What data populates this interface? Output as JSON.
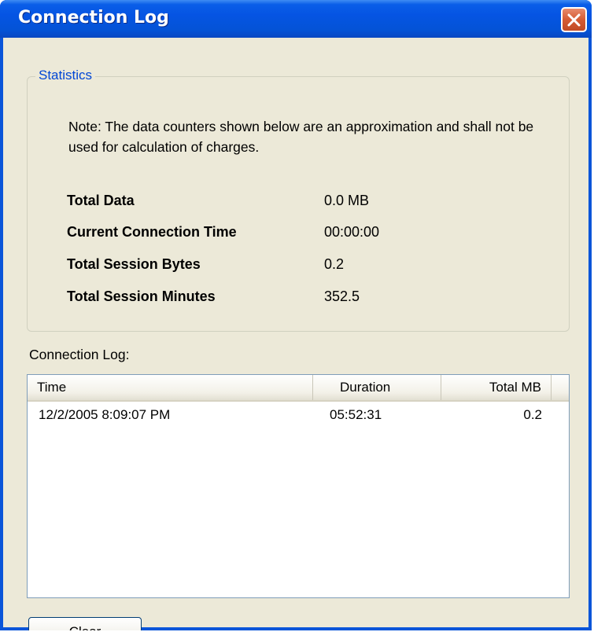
{
  "window": {
    "title": "Connection Log",
    "close_icon": "close-x-icon"
  },
  "statistics": {
    "legend": "Statistics",
    "note": "Note: The data counters shown below are an approximation and shall not be used for calculation of charges.",
    "rows": [
      {
        "label": "Total Data",
        "value": "0.0 MB"
      },
      {
        "label": "Current Connection Time",
        "value": "00:00:00"
      },
      {
        "label": "Total Session Bytes",
        "value": "0.2"
      },
      {
        "label": "Total Session Minutes",
        "value": "352.5"
      }
    ]
  },
  "connection_log": {
    "label": "Connection Log:",
    "columns": [
      "Time",
      "Duration",
      "Total MB"
    ],
    "rows": [
      {
        "time": "12/2/2005 8:09:07 PM",
        "duration": "05:52:31",
        "total_mb": "0.2"
      }
    ]
  },
  "buttons": {
    "clear": "Clear"
  },
  "colors": {
    "titlebar": "#0554e3",
    "client_bg": "#ece9d8",
    "legend_text": "#0046d5",
    "close_button": "#d55b34"
  }
}
